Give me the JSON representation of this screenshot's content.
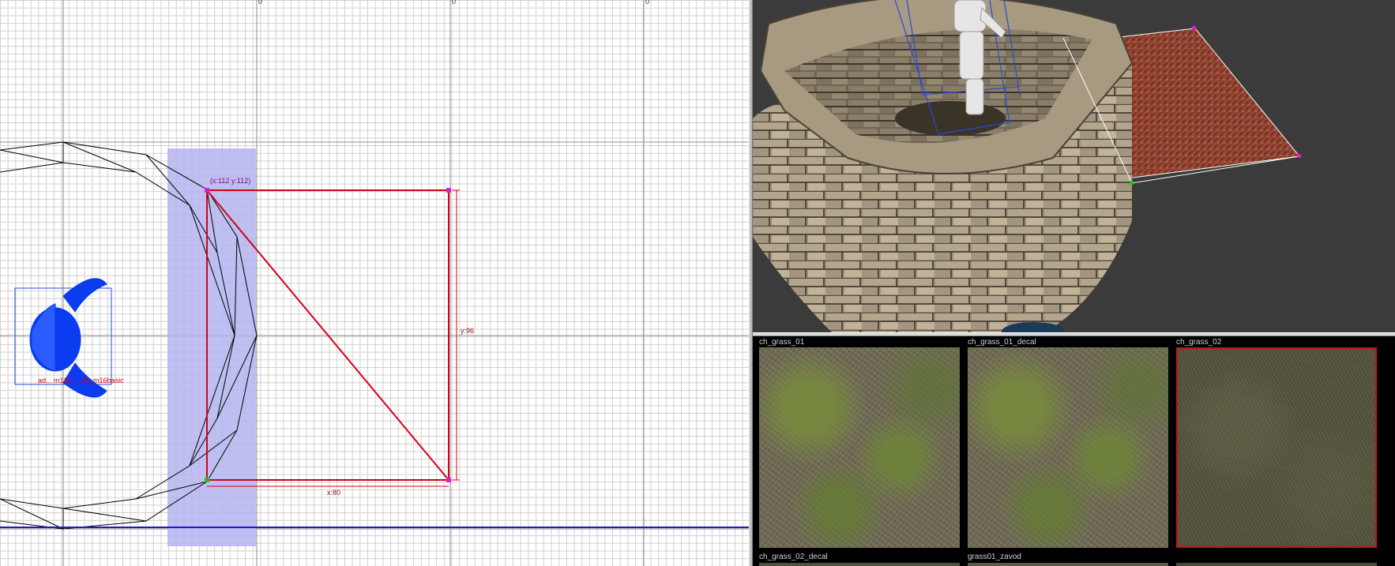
{
  "view2d": {
    "ruler_marks": [
      "0",
      "0",
      "0"
    ],
    "vertex_coord_label": "(x:112  y:112)",
    "height_label": "y:96",
    "width_label": "x:80",
    "entity_label": "ad... m130_ ..98_m16basic",
    "colors": {
      "grid": "#cfcfcf",
      "selection_red": "#d4001a",
      "selection_fill": "#b4b4f0",
      "entity_wire": "#0a3cf0",
      "horizon_line": "#1a1ad0",
      "vertex_handle": "#e01ccc",
      "vertex_green": "#22c022"
    }
  },
  "view3d": {
    "colors": {
      "background": "#3b3b3b",
      "stone": "#8a7e6c",
      "ground_patch": "#8a3a2a",
      "wire_white": "#ffffff",
      "wire_blue": "#2a4bd6"
    }
  },
  "texture_browser": {
    "tiles": [
      {
        "label": "ch_grass_01",
        "selected": false
      },
      {
        "label": "ch_grass_01_decal",
        "selected": false
      },
      {
        "label": "ch_grass_02",
        "selected": true
      }
    ],
    "bottom_labels": [
      "ch_grass_02_decal",
      "grass01_zavod"
    ]
  }
}
